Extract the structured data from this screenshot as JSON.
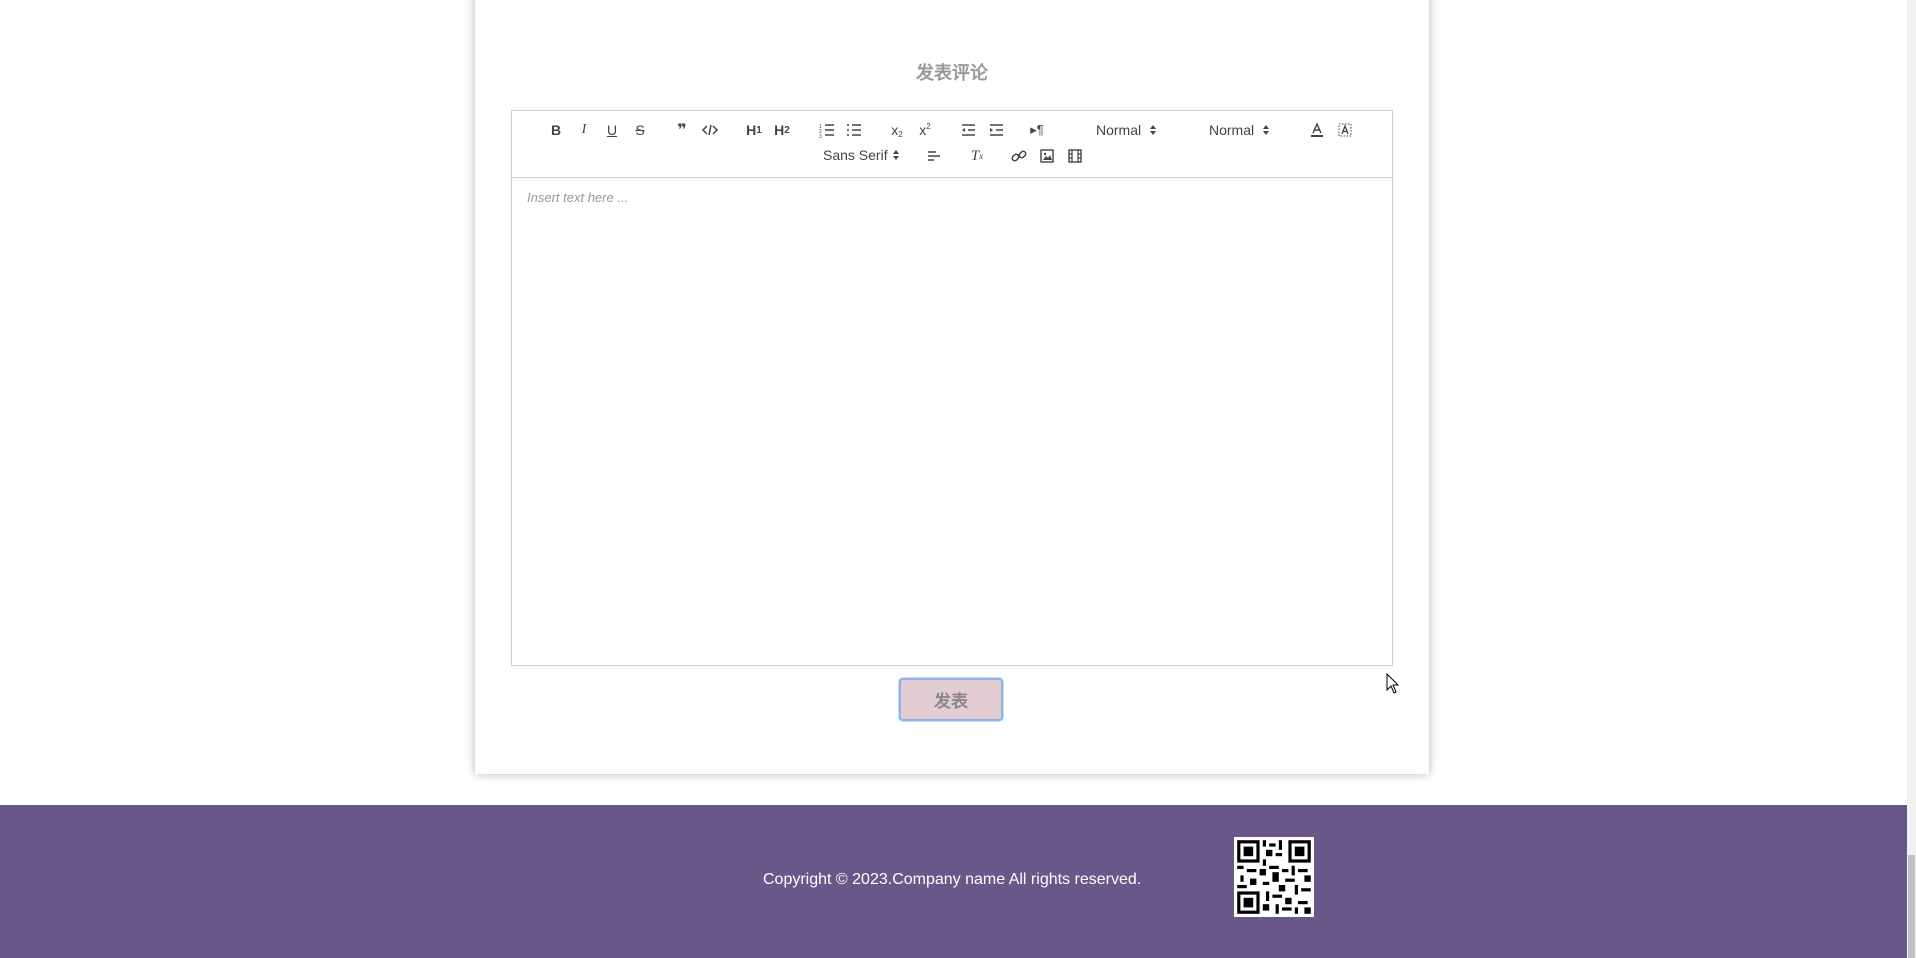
{
  "comment": {
    "title": "发表评论",
    "placeholder": "Insert text here ...",
    "submit_label": "发表"
  },
  "toolbar": {
    "header_picker": "Normal",
    "size_picker": "Normal",
    "font_picker": "Sans Serif"
  },
  "footer": {
    "copyright": "Copyright © 2023.Company name All rights reserved."
  },
  "colors": {
    "footer_bg": "#685889",
    "button_bg": "#e3cdd3",
    "button_border": "#8ab4ea"
  }
}
